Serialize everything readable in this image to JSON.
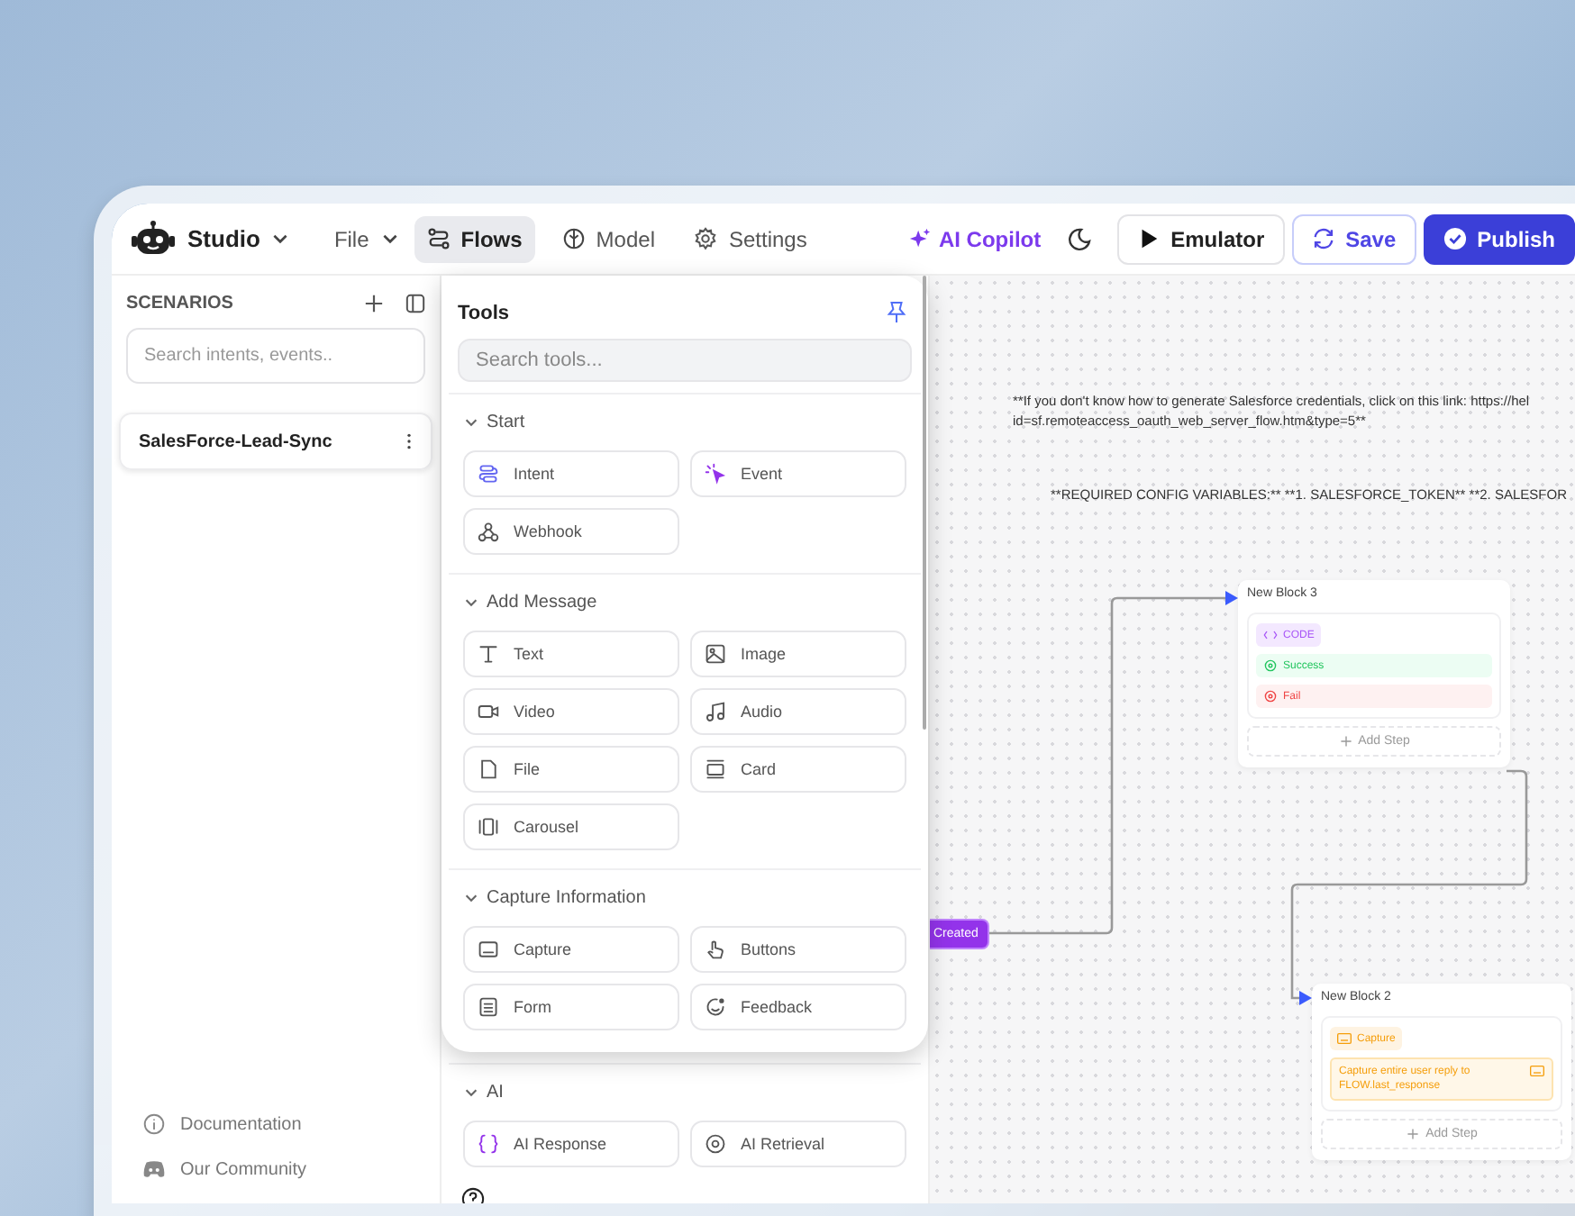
{
  "topbar": {
    "product": "Studio",
    "menus": [
      {
        "label": "File"
      }
    ],
    "tabs": [
      {
        "label": "Flows",
        "kind": "flows",
        "selected": true
      },
      {
        "label": "Model",
        "kind": "model",
        "selected": false
      },
      {
        "label": "Settings",
        "kind": "settings",
        "selected": false
      }
    ],
    "copilot": "AI Copilot",
    "emulator": "Emulator",
    "save": "Save",
    "publish": "Publish"
  },
  "sidebar": {
    "title": "SCENARIOS",
    "search_placeholder": "Search intents, events..",
    "scenarios": [
      {
        "name": "SalesForce-Lead-Sync",
        "selected": true
      }
    ],
    "links": [
      {
        "label": "Documentation",
        "kind": "info"
      },
      {
        "label": "Our Community",
        "kind": "community"
      }
    ]
  },
  "tools": {
    "title": "Tools",
    "pinned": true,
    "search_placeholder": "Search tools...",
    "sections": [
      {
        "title": "Start",
        "expanded": true,
        "items": [
          {
            "label": "Intent",
            "kind": "intent"
          },
          {
            "label": "Event",
            "kind": "event"
          },
          {
            "label": "Webhook",
            "kind": "webhook"
          }
        ]
      },
      {
        "title": "Add Message",
        "expanded": true,
        "items": [
          {
            "label": "Text",
            "kind": "text"
          },
          {
            "label": "Image",
            "kind": "image"
          },
          {
            "label": "Video",
            "kind": "video"
          },
          {
            "label": "Audio",
            "kind": "audio"
          },
          {
            "label": "File",
            "kind": "file"
          },
          {
            "label": "Card",
            "kind": "card"
          },
          {
            "label": "Carousel",
            "kind": "carousel"
          }
        ]
      },
      {
        "title": "Capture Information",
        "expanded": true,
        "items": [
          {
            "label": "Capture",
            "kind": "capture"
          },
          {
            "label": "Buttons",
            "kind": "buttons"
          },
          {
            "label": "Form",
            "kind": "form"
          },
          {
            "label": "Feedback",
            "kind": "feedback"
          }
        ]
      }
    ]
  },
  "panel_sections": [
    {
      "title": "AI",
      "expanded": true,
      "items": [
        {
          "label": "AI Response",
          "kind": "ai-response"
        },
        {
          "label": "AI Retrieval",
          "kind": "ai-retrieval"
        }
      ]
    }
  ],
  "canvas": {
    "notes": [
      "**If you don't know how to generate Salesforce credentials, click on this link: https://hel\nid=sf.remoteaccess_oauth_web_server_flow.htm&type=5**",
      "**REQUIRED CONFIG VARIABLES:** **1. SALESFORCE_TOKEN** **2. SALESFOR"
    ],
    "trigger": {
      "label": "Created"
    },
    "blocks": [
      {
        "title": "New Block 3",
        "badge": {
          "label": "CODE",
          "kind": "code"
        },
        "outputs": [
          {
            "label": "Success",
            "kind": "success"
          },
          {
            "label": "Fail",
            "kind": "fail"
          }
        ],
        "add_step": "Add Step"
      },
      {
        "title": "New Block 2",
        "badge": {
          "label": "Capture",
          "kind": "capture"
        },
        "prompt": "Capture entire user reply to FLOW.last_response",
        "add_step": "Add Step"
      }
    ]
  }
}
